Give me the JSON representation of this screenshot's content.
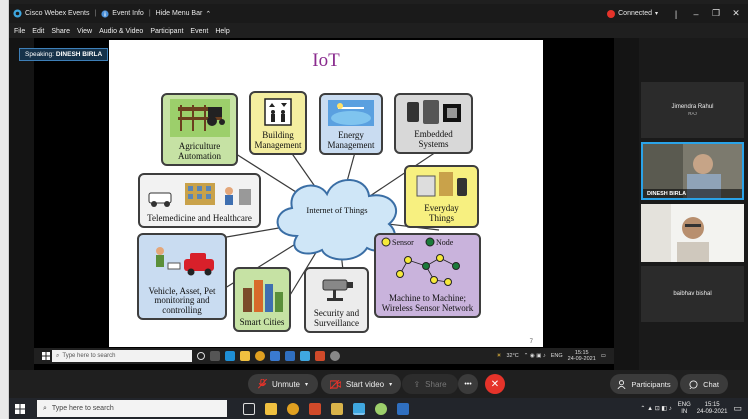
{
  "titlebar": {
    "app_name": "Cisco Webex Events",
    "event_info": "Event Info",
    "hide_menu": "Hide Menu Bar",
    "connected": "Connected",
    "minimize": "–",
    "restore": "❐",
    "close": "✕"
  },
  "menu": [
    "File",
    "Edit",
    "Share",
    "View",
    "Audio & Video",
    "Participant",
    "Event",
    "Help"
  ],
  "speaking": {
    "prefix": "Speaking:",
    "name": "DINESH BIRLA"
  },
  "slide": {
    "title": "IoT",
    "center": "Internet of Things",
    "page": "7",
    "boxes": {
      "agriculture": [
        "Agriculture",
        "Automation"
      ],
      "building": [
        "Building",
        "Management"
      ],
      "energy": [
        "Energy",
        "Management"
      ],
      "embedded": [
        "Embedded",
        "Systems"
      ],
      "telemedicine": [
        "Telemedicine and Healthcare"
      ],
      "everyday": [
        "Everyday",
        "Things"
      ],
      "vehicle": [
        "Vehicle, Asset, Pet",
        "monitoring and",
        "controlling"
      ],
      "smartcities": [
        "Smart Cities"
      ],
      "security": [
        "Security and",
        "Surveillance"
      ],
      "m2m": [
        "Machine to Machine;",
        "Wireless Sensor Network"
      ]
    },
    "legend": {
      "sensor": "Sensor",
      "node": "Node"
    }
  },
  "inner_taskbar": {
    "search_placeholder": "Type here to search",
    "temp": "32°C",
    "lang": "ENG",
    "time": "15:15",
    "date": "24-09-2021"
  },
  "participants": [
    {
      "name": "Jimendra Rahul",
      "sub": "RAJ"
    },
    {
      "name": "DINESH BIRLA"
    },
    {
      "name": ""
    },
    {
      "name": "baibhav bishal"
    }
  ],
  "controls": {
    "unmute": "Unmute",
    "start_video": "Start video",
    "share": "Share",
    "more": "•••",
    "participants": "Participants",
    "chat": "Chat"
  },
  "taskbar": {
    "search_placeholder": "Type here to search",
    "lang": "ENG",
    "region": "IN",
    "time": "15:15",
    "date": "24-09-2021"
  },
  "colors": {
    "accent": "#2aa3e8",
    "end_call": "#e5332a",
    "connected_dot": "#e5332a",
    "slide_title": "#8a2b8e"
  }
}
